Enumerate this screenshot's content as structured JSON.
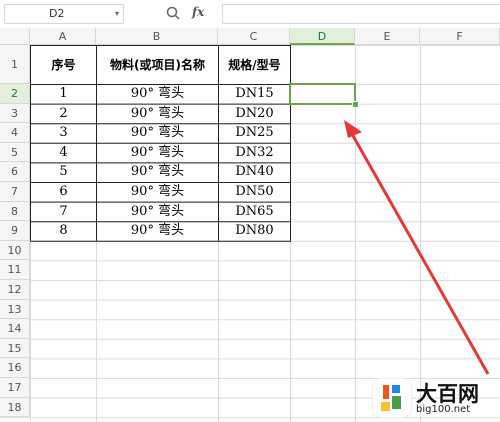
{
  "formula_bar": {
    "name_box": "D2",
    "fx_label": "fx",
    "formula": ""
  },
  "columns": [
    "A",
    "B",
    "C",
    "D",
    "E",
    "F"
  ],
  "selected_column": "D",
  "row_numbers": [
    "1",
    "2",
    "3",
    "4",
    "5",
    "6",
    "7",
    "8",
    "9",
    "10",
    "11",
    "12",
    "13",
    "14",
    "15",
    "16",
    "17",
    "18"
  ],
  "selected_row": "2",
  "table": {
    "headers": [
      "序号",
      "物料(或项目)名称",
      "规格/型号"
    ],
    "rows": [
      [
        "1",
        "90° 弯头",
        "DN15"
      ],
      [
        "2",
        "90° 弯头",
        "DN20"
      ],
      [
        "3",
        "90° 弯头",
        "DN25"
      ],
      [
        "4",
        "90° 弯头",
        "DN32"
      ],
      [
        "5",
        "90° 弯头",
        "DN40"
      ],
      [
        "6",
        "90° 弯头",
        "DN50"
      ],
      [
        "7",
        "90° 弯头",
        "DN65"
      ],
      [
        "8",
        "90° 弯头",
        "DN80"
      ]
    ]
  },
  "active_cell": {
    "ref": "D2",
    "value": ""
  },
  "watermark": {
    "brand": "大百网",
    "url": "big100.net"
  },
  "colors": {
    "selection": "#6aa84f",
    "arrow": "#e53935"
  }
}
